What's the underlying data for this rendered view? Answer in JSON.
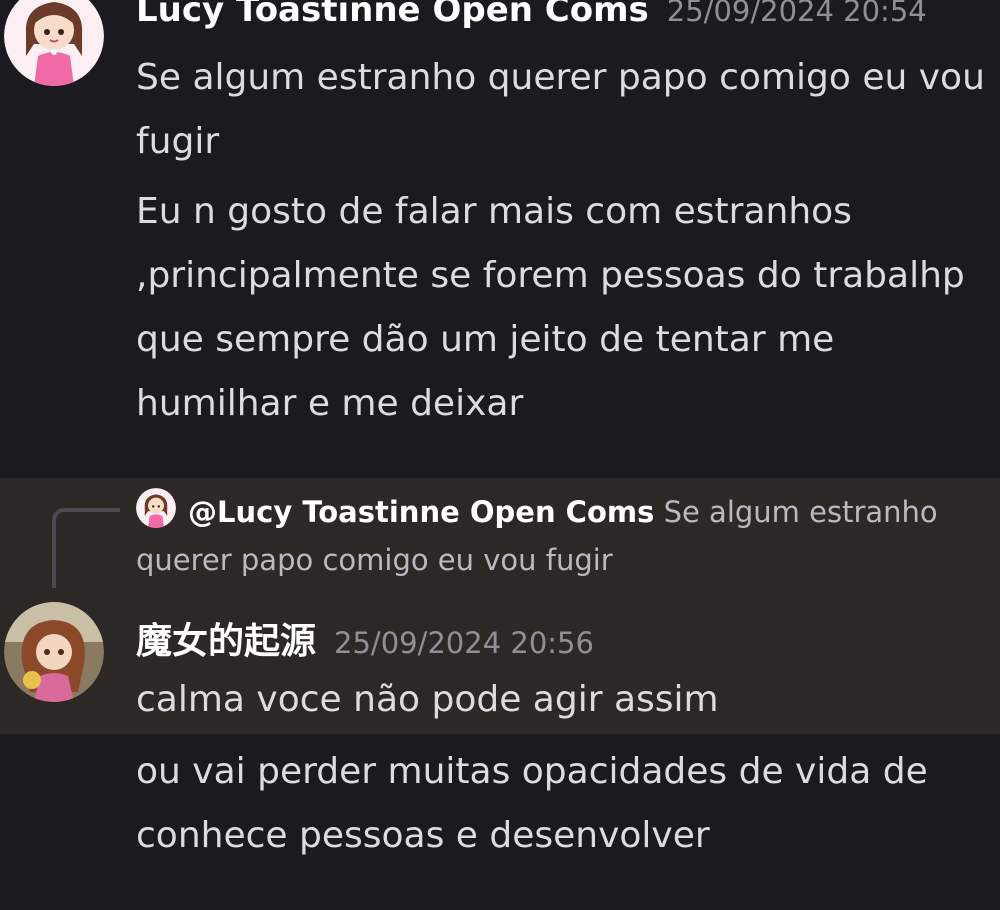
{
  "messages": [
    {
      "author": "Lucy Toastinne Open Coms",
      "timestamp": "25/09/2024 20:54",
      "avatar_icon": "anime-girl-pink-avatar",
      "lines": [
        "Se algum estranho querer papo comigo eu vou fugir",
        "Eu n gosto de falar mais com estranhos ,principalmente se forem pessoas do trabalhp que sempre dão um jeito de tentar me humilhar e me deixar"
      ]
    },
    {
      "author": "魔女的起源",
      "timestamp": "25/09/2024 20:56",
      "avatar_icon": "anime-girl-brown-hair-avatar",
      "reply_to": {
        "mention": "@Lucy Toastinne Open Coms",
        "preview": "Se algum estranho querer papo comigo eu vou fugir"
      },
      "lines": [
        "calma voce não pode agir assim",
        "ou vai perder muitas opacidades de vida de conhece pessoas e desenvolver"
      ]
    }
  ],
  "colors": {
    "background": "#1a1a1f",
    "reply_highlight": "#2b2825",
    "username": "#ffffff",
    "timestamp": "#8f9097",
    "text": "#dcdce0"
  }
}
